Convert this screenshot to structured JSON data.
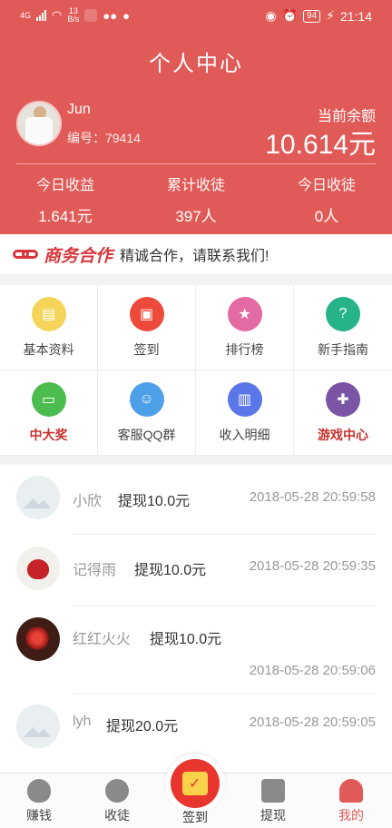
{
  "status_bar": {
    "network": "4G",
    "speed_value": "13",
    "speed_unit": "B/s",
    "battery": "94",
    "time": "21:14"
  },
  "header": {
    "title": "个人中心",
    "username": "Jun",
    "user_id": "编号：79414",
    "balance_label": "当前余额",
    "balance_value": "10.614元"
  },
  "stats": [
    {
      "label": "今日收益",
      "value": "1.641元"
    },
    {
      "label": "累计收徒",
      "value": "397人"
    },
    {
      "label": "今日收徒",
      "value": "0人"
    }
  ],
  "business": {
    "brand": "商务合作",
    "slogan": "精诚合作，请联系我们!"
  },
  "grid": [
    {
      "label": "基本资料",
      "icon": "document-icon",
      "color": "#f5d45a",
      "emphasis": false
    },
    {
      "label": "签到",
      "icon": "calendar-icon",
      "color": "#ee4a3b",
      "emphasis": false
    },
    {
      "label": "排行榜",
      "icon": "stars-icon",
      "color": "#e36aa2",
      "emphasis": false
    },
    {
      "label": "新手指南",
      "icon": "question-icon",
      "color": "#26b38a",
      "emphasis": false
    },
    {
      "label": "中大奖",
      "icon": "wallet-icon",
      "color": "#4cbc4f",
      "emphasis": true
    },
    {
      "label": "客服QQ群",
      "icon": "qq-icon",
      "color": "#4d9fe8",
      "emphasis": false
    },
    {
      "label": "收入明细",
      "icon": "ledger-icon",
      "color": "#5b76e8",
      "emphasis": false
    },
    {
      "label": "游戏中心",
      "icon": "gamepad-icon",
      "color": "#7a55a6",
      "emphasis": true
    }
  ],
  "withdrawals": [
    {
      "name": "小欣",
      "action": "提现10.0元",
      "time": "2018-05-28 20:59:58"
    },
    {
      "name": "记得雨",
      "action": "提现10.0元",
      "time": "2018-05-28 20:59:35"
    },
    {
      "name": "红红火火",
      "action": "提现10.0元",
      "time": "2018-05-28 20:59:06"
    },
    {
      "name": "lyh",
      "action": "提现20.0元",
      "time": "2018-05-28 20:59:05"
    }
  ],
  "nav": {
    "earn": "赚钱",
    "apprentice": "收徒",
    "checkin": "签到",
    "withdraw": "提现",
    "mine": "我的"
  }
}
